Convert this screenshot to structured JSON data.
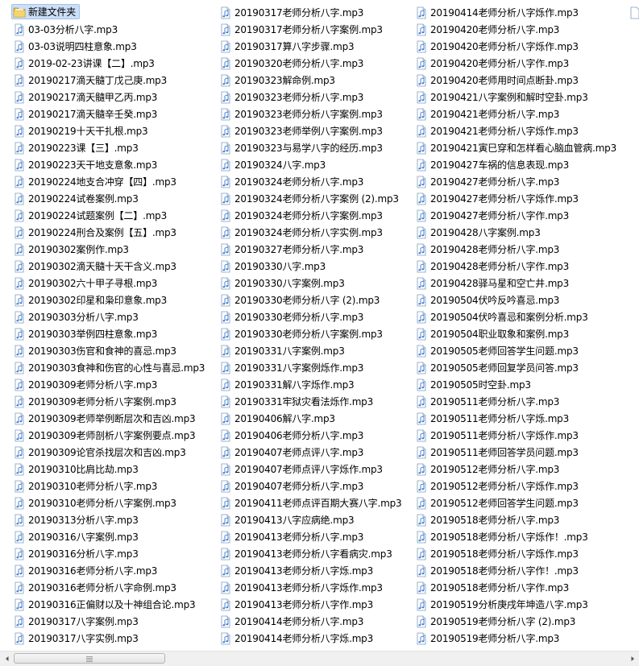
{
  "folder": {
    "name": "新建文件夹",
    "icon": "folder-icon"
  },
  "file_icon": "audio-file-icon",
  "columns": [
    [
      "03-03分析八字.mp3",
      "03-03说明四柱意象.mp3",
      "2019-02-23讲课【二】.mp3",
      "20190217滴天髓丁戊己庚.mp3",
      "20190217滴天髓甲乙丙.mp3",
      "20190217滴天髓辛壬癸.mp3",
      "20190219十天干扎根.mp3",
      "20190223课【三】.mp3",
      "20190223天干地支意象.mp3",
      "20190224地支合冲穿【四】.mp3",
      "20190224试卷案例.mp3",
      "20190224试题案例【二】.mp3",
      "20190224刑合及案例【五】.mp3",
      "20190302案例作.mp3",
      "20190302滴天髓十天干含义.mp3",
      "20190302六十甲子寻根.mp3",
      "20190302印星和枭印意象.mp3",
      "20190303分析八字.mp3",
      "20190303举例四柱意象.mp3",
      "20190303伤官和食神的喜忌.mp3",
      "20190303食神和伤官的心性与喜忌.mp3",
      "20190309老师分析八字.mp3",
      "20190309老师分析八字案例.mp3",
      "20190309老师举例断层次和吉凶.mp3",
      "20190309老师剖析八字案例要点.mp3",
      "20190309论官杀找层次和吉凶.mp3",
      "20190310比肩比劫.mp3",
      "20190310老师分析八字.mp3",
      "20190310老师分析八字案例.mp3",
      "20190313分析八字.mp3",
      "20190316八字案例.mp3",
      "20190316分析八字.mp3",
      "20190316老师分析八字.mp3",
      "20190316老师分析八字命例.mp3",
      "20190316正偏财以及十神组合论.mp3",
      "20190317八字案例.mp3",
      "20190317八字实例.mp3"
    ],
    [
      "20190317老师分析八字.mp3",
      "20190317老师分析八字案例.mp3",
      "20190317算八字步骤.mp3",
      "20190320老师分析八字.mp3",
      "20190323解命例.mp3",
      "20190323老师分析八字.mp3",
      "20190323老师分析八字案例.mp3",
      "20190323老师举例八字案例.mp3",
      "20190323与易学八字的经历.mp3",
      "20190324八字.mp3",
      "20190324老师分析八字.mp3",
      "20190324老师分析八字案例 (2).mp3",
      "20190324老师分析八字案例.mp3",
      "20190324老师分析八字实例.mp3",
      "20190327老师分析八字.mp3",
      "20190330八字.mp3",
      "20190330八字案例.mp3",
      "20190330老师分析八字 (2).mp3",
      "20190330老师分析八字.mp3",
      "20190330老师分析八字案例.mp3",
      "20190331八字案例.mp3",
      "20190331八字案例烁作.mp3",
      "20190331解八字烁作.mp3",
      "20190331牢狱灾看法烁作.mp3",
      "20190406解八字.mp3",
      "20190406老师分析八字.mp3",
      "20190407老师点评八字.mp3",
      "20190407老师点评八字烁作.mp3",
      "20190407老师分析八字.mp3",
      "20190411老师点评百期大赛八字.mp3",
      "20190413八字应病绝.mp3",
      "20190413老师分析八字.mp3",
      "20190413老师分析八字看病灾.mp3",
      "20190413老师分析八字烁.mp3",
      "20190413老师分析八字烁作.mp3",
      "20190413老师分析八字作.mp3",
      "20190414老师分析八字.mp3",
      "20190414老师分析八字烁.mp3"
    ],
    [
      "20190414老师分析八字烁作.mp3",
      "20190420老师分析八字.mp3",
      "20190420老师分析八字烁作.mp3",
      "20190420老师分析八字作.mp3",
      "20190420老师用时间点断卦.mp3",
      "20190421八字案例和解时空卦.mp3",
      "20190421老师分析八字.mp3",
      "20190421老师分析八字烁作.mp3",
      "20190421寅巳穿和怎样看心脑血管病.mp3",
      "20190427车祸的信息表现.mp3",
      "20190427老师分析八字.mp3",
      "20190427老师分析八字烁作.mp3",
      "20190427老师分析八字作.mp3",
      "20190428八字案例.mp3",
      "20190428老师分析八字.mp3",
      "20190428老师分析八字作.mp3",
      "20190428驿马星和空亡井.mp3",
      "20190504伏吟反吟喜忌.mp3",
      "20190504伏吟喜忌和案例分析.mp3",
      "20190504职业取象和案例.mp3",
      "20190505老师回答学生问题.mp3",
      "20190505老师回复学员问答.mp3",
      "20190505时空卦.mp3",
      "20190511老师分析八字.mp3",
      "20190511老师分析八字烁.mp3",
      "20190511老师分析八字烁作.mp3",
      "20190511老师回答学员问题.mp3",
      "20190512老师分析八字.mp3",
      "20190512老师分析八字烁作.mp3",
      "20190512老师回答学生问题.mp3",
      "20190518老师分析八字.mp3",
      "20190518老师分析八字烁作！.mp3",
      "20190518老师分析八字烁作.mp3",
      "20190518老师分析八字作！.mp3",
      "20190518老师分析八字作.mp3",
      "20190519分析庚戌年坤造八字.mp3",
      "20190519老师分析八字 (2).mp3",
      "20190519老师分析八字.mp3"
    ]
  ],
  "colors": {
    "selection_bg": "#ccdff6",
    "selection_border": "#9ec3ef",
    "folder_yellow": "#f2cf5b",
    "icon_blue": "#3a77c9"
  }
}
